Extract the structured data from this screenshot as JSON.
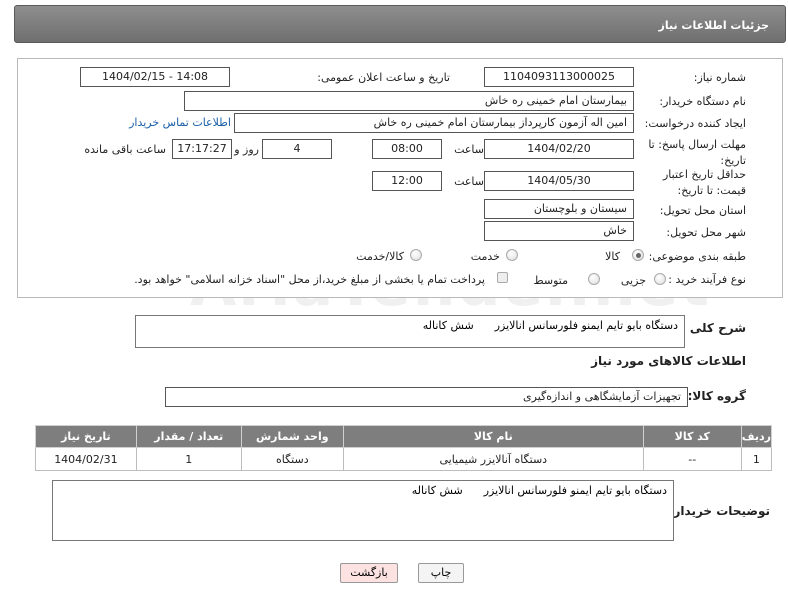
{
  "title": "جزئیات اطلاعات نیاز",
  "fields": {
    "need_number_label": "شماره نیاز:",
    "need_number": "1104093113000025",
    "announce_datetime_label": "تاریخ و ساعت اعلان عمومی:",
    "announce_datetime": "1404/02/15 - 14:08",
    "buyer_org_label": "نام دستگاه خریدار:",
    "buyer_org": "بیمارستان امام خمینی  ره  خاش",
    "requester_label": "ایجاد کننده درخواست:",
    "requester": "امین اله آزمون کارپرداز بیمارستان امام خمینی  ره  خاش",
    "buyer_contact_link": "اطلاعات تماس خریدار",
    "reply_deadline_label": "مهلت ارسال پاسخ: تا تاریخ:",
    "reply_date": "1404/02/20",
    "time_label": "ساعت",
    "reply_time": "08:00",
    "days_value": "4",
    "days_label": "روز و",
    "remaining_time": "17:17:27",
    "remaining_label": "ساعت باقی مانده",
    "price_validity_label": "حداقل تاریخ اعتبار قیمت: تا تاریخ:",
    "price_validity_date": "1404/05/30",
    "price_validity_time": "12:00",
    "province_label": "استان محل تحویل:",
    "province": "سیستان و بلوچستان",
    "city_label": "شهر محل تحویل:",
    "city": "خاش",
    "category_label": "طبقه بندی موضوعی:",
    "category_options": [
      "کالا",
      "خدمت",
      "کالا/خدمت"
    ],
    "process_label": "نوع فرآیند خرید :",
    "process_options": [
      "جزیی",
      "متوسط"
    ],
    "payment_note": "پرداخت تمام یا بخشی از مبلغ خرید،از محل \"اسناد خزانه اسلامی\" خواهد بود."
  },
  "summary": {
    "label": "شرح کلی نیاز:",
    "value": "دستگاه بایو تایم ایمنو فلورسانس انالایزر      شش کاناله"
  },
  "goods_section_title": "اطلاعات کالاهای مورد نیاز",
  "goods_group": {
    "label": "گروه کالا:",
    "value": "تجهیزات آزمایشگاهی و اندازه‌گیری"
  },
  "table": {
    "headers": [
      "ردیف",
      "کد کالا",
      "نام کالا",
      "واحد شمارش",
      "تعداد / مقدار",
      "تاریخ نیاز"
    ],
    "rows": [
      [
        "1",
        "--",
        "دستگاه آنالایزر شیمیایی",
        "دستگاه",
        "1",
        "1404/02/31"
      ]
    ]
  },
  "buyer_notes": {
    "label": "توضیحات خریدار:",
    "value": "دستگاه بایو تایم ایمنو فلورسانس انالایزر      شش کاناله"
  },
  "buttons": {
    "print": "چاپ",
    "back": "بازگشت"
  },
  "watermark": "AriaTender.net",
  "colors": {
    "title_bar": "#7a7a7a",
    "table_header": "#7e7e7e",
    "link": "#1a5ea8",
    "back_button": "#fde2e2"
  }
}
